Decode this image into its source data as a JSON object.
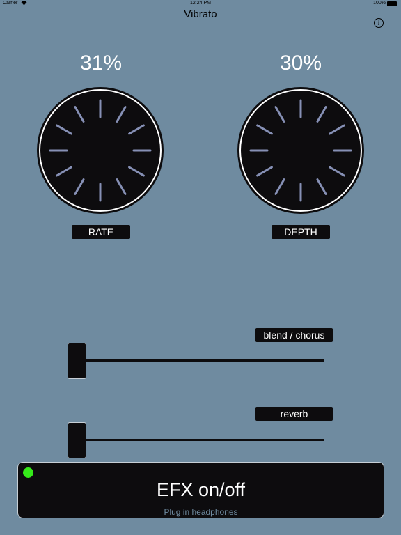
{
  "status_bar": {
    "carrier": "Carrier",
    "wifi_icon": "wifi-icon",
    "time": "12:24 PM",
    "battery": "100%"
  },
  "nav": {
    "title": "Vibrato",
    "info_icon": "info-icon",
    "info_glyph": "i"
  },
  "knobs": [
    {
      "value": "31%",
      "label": "RATE"
    },
    {
      "value": "30%",
      "label": "DEPTH"
    }
  ],
  "sliders": [
    {
      "label": "blend / chorus",
      "value_fraction": 0.0
    },
    {
      "label": "reverb",
      "value_fraction": 0.0
    }
  ],
  "efx": {
    "label": "EFX on/off",
    "hint": "Plug in headphones",
    "led_color": "#35ea1a"
  },
  "colors": {
    "background": "#6f8ba0",
    "panel": "#0d0c0e",
    "tick": "#8690b5",
    "accent_green": "#35ea1a"
  }
}
